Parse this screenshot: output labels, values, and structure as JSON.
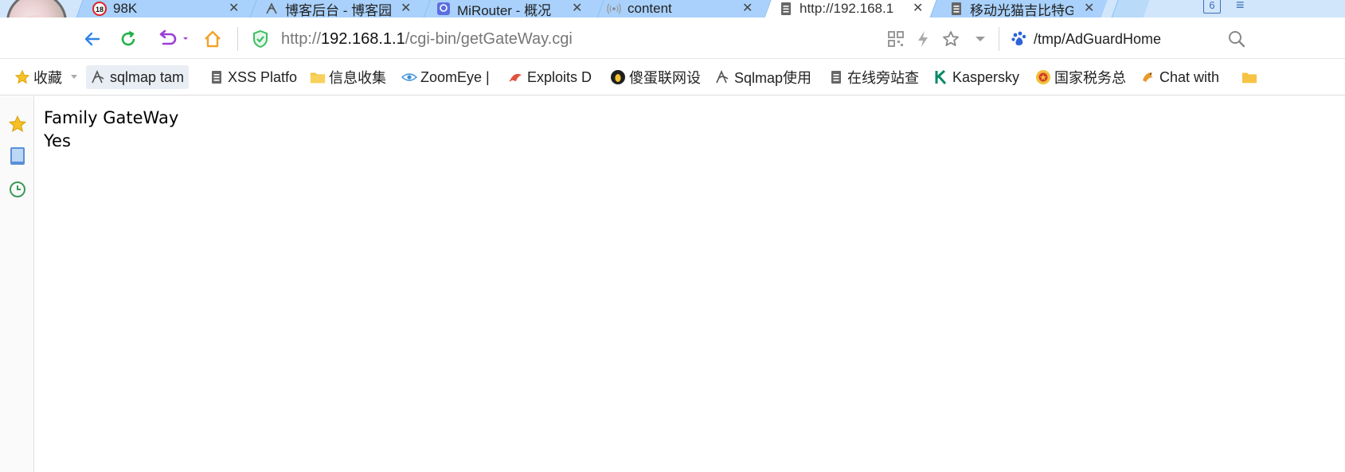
{
  "tabs": [
    {
      "label": "98K",
      "icon": "age-18-icon",
      "active": false
    },
    {
      "label": "博客后台 - 博客园",
      "icon": "pen-logo-icon",
      "active": false
    },
    {
      "label": "MiRouter - 概况",
      "icon": "mirouter-icon",
      "active": false
    },
    {
      "label": "content",
      "icon": "broadcast-icon",
      "active": false
    },
    {
      "label": "http://192.168.1",
      "icon": "page-icon",
      "active": true
    },
    {
      "label": "移动光猫吉比特GS",
      "icon": "page-icon",
      "active": false
    }
  ],
  "tab_count": "6",
  "address": {
    "scheme": "http://",
    "host": "192.168.1.1",
    "path": "/cgi-bin/getGateWay.cgi"
  },
  "search": {
    "text": "/tmp/AdGuardHome"
  },
  "bookmarks": [
    {
      "label": "收藏",
      "icon": "star-icon"
    },
    {
      "label": "sqlmap tam",
      "icon": "sqlmap-logo-icon"
    },
    {
      "label": "XSS Platfo",
      "icon": "page-icon"
    },
    {
      "label": "信息收集",
      "icon": "folder-icon"
    },
    {
      "label": "ZoomEye |",
      "icon": "zoomeye-eye-icon"
    },
    {
      "label": "Exploits D",
      "icon": "exploit-bug-icon"
    },
    {
      "label": "傻蛋联网设",
      "icon": "shodan-icon"
    },
    {
      "label": "Sqlmap使用",
      "icon": "sqlmap-logo-icon"
    },
    {
      "label": "在线旁站查",
      "icon": "page-icon"
    },
    {
      "label": "Kaspersky",
      "icon": "kaspersky-k-icon"
    },
    {
      "label": "国家税务总",
      "icon": "emblem-icon"
    },
    {
      "label": "Chat with",
      "icon": "chat-bird-icon"
    }
  ],
  "page": {
    "line1": "Family GateWay",
    "line2": "Yes"
  },
  "colors": {
    "tabbar": "#d2e6fb",
    "tab": "#a9d1fb",
    "accent_blue": "#2f84e6",
    "reload_green": "#24b24a",
    "undo_purple": "#9b3fd6",
    "home_orange": "#f0a326",
    "shield_green": "#3bbf62"
  }
}
